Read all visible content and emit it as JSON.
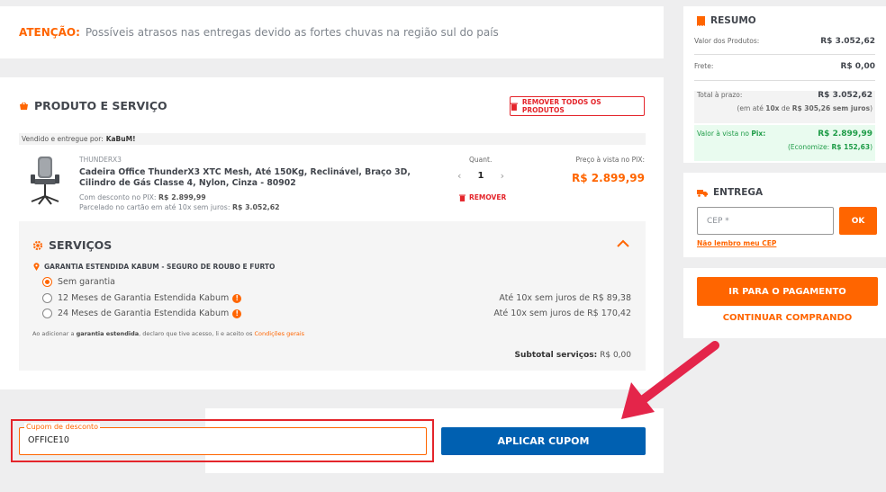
{
  "alert": {
    "label": "ATENÇÃO:",
    "message": "Possíveis atrasos nas entregas devido as fortes chuvas na região sul do país"
  },
  "product_section": {
    "title": "PRODUTO E SERVIÇO",
    "remove_all_label": "REMOVER TODOS OS PRODUTOS",
    "seller_prefix": "Vendido e entregue por:",
    "seller_name": "KaBuM!",
    "item": {
      "brand": "THUNDERX3",
      "name": "Cadeira Office ThunderX3 XTC Mesh, Até 150Kg, Reclinável, Braço 3D, Cilindro de Gás Classe 4, Nylon, Cinza - 80902",
      "pix_discount_label": "Com desconto no PIX:",
      "pix_discount_value": "R$ 2.899,99",
      "installment_label": "Parcelado no cartão em até 10x sem juros:",
      "installment_value": "R$ 3.052,62",
      "quantity_label": "Quant.",
      "quantity": "1",
      "remove_label": "REMOVER",
      "pix_price_label": "Preço à vista no PIX:",
      "pix_price": "R$ 2.899,99"
    }
  },
  "services": {
    "title": "SERVIÇOS",
    "guarantee_title": "GARANTIA ESTENDIDA KABUM - SEGURO DE ROUBO E FURTO",
    "options": [
      {
        "label": "Sem garantia",
        "price": "",
        "selected": true
      },
      {
        "label": "12 Meses de Garantia Estendida Kabum",
        "price": "Até 10x sem juros de R$ 89,38",
        "selected": false
      },
      {
        "label": "24 Meses de Garantia Estendida Kabum",
        "price": "Até 10x sem juros de R$ 170,42",
        "selected": false
      }
    ],
    "terms_prefix": "Ao adicionar a",
    "terms_bold": "garantia estendida",
    "terms_middle": ", declaro que tive acesso, li e aceito os",
    "terms_link": "Condições gerais",
    "subtotal_label": "Subtotal serviços:",
    "subtotal_value": "R$ 0,00"
  },
  "coupon": {
    "label": "Cupom de desconto",
    "value": "OFFICE10",
    "apply_label": "APLICAR CUPOM"
  },
  "summary": {
    "title": "RESUMO",
    "products_label": "Valor dos Produtos:",
    "products_value": "R$ 3.052,62",
    "shipping_label": "Frete:",
    "shipping_value": "R$ 0,00",
    "total_label": "Total à prazo:",
    "total_value": "R$ 3.052,62",
    "total_note_prefix": "(em até",
    "total_note_bold1": "10x",
    "total_note_mid": "de",
    "total_note_bold2": "R$ 305,26 sem juros",
    "total_note_suffix": ")",
    "pix_label_prefix": "Valor à vista no",
    "pix_label_bold": "Pix:",
    "pix_value": "R$ 2.899,99",
    "save_prefix": "(Economize:",
    "save_value": "R$ 152,63",
    "save_suffix": ")"
  },
  "delivery": {
    "title": "ENTREGA",
    "cep_placeholder": "CEP *",
    "ok_label": "OK",
    "forgot_cep": "Não lembro meu CEP"
  },
  "actions": {
    "pay_label": "IR PARA O PAGAMENTO",
    "continue_label": "CONTINUAR COMPRANDO"
  },
  "colors": {
    "accent": "#ff6500",
    "blue": "#0060b1",
    "red": "#e4252b",
    "green": "#1f9c48"
  }
}
